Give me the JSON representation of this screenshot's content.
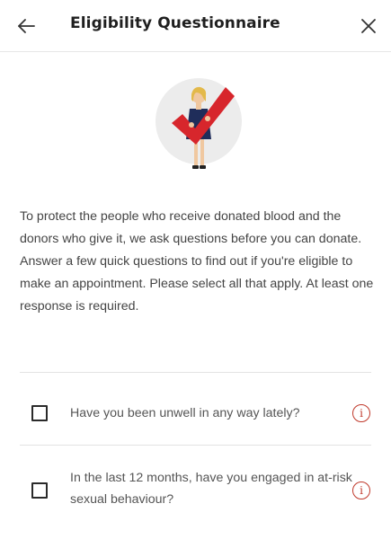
{
  "header": {
    "title": "Eligibility Questionnaire",
    "back_icon": "arrow-left-icon",
    "close_icon": "close-icon"
  },
  "illustration": {
    "icon": "person-holding-checkmark-illustration",
    "accent_color": "#d7262c",
    "circle_color": "#ececec"
  },
  "intro": {
    "text": "To protect the people who receive donated blood and the donors who give it, we ask questions before you can donate. Answer a few quick questions to find out if you're eligible to make an appointment. Please select all that apply. At least one response is required."
  },
  "questions": [
    {
      "text": "Have you been unwell in any way lately?",
      "checked": false,
      "info_icon": "info-icon"
    },
    {
      "text": "In the last 12 months, have you engaged in at-risk sexual behaviour?",
      "checked": false,
      "info_icon": "info-icon"
    }
  ],
  "colors": {
    "accent": "#c0392b",
    "divider": "#e3e3e3"
  }
}
